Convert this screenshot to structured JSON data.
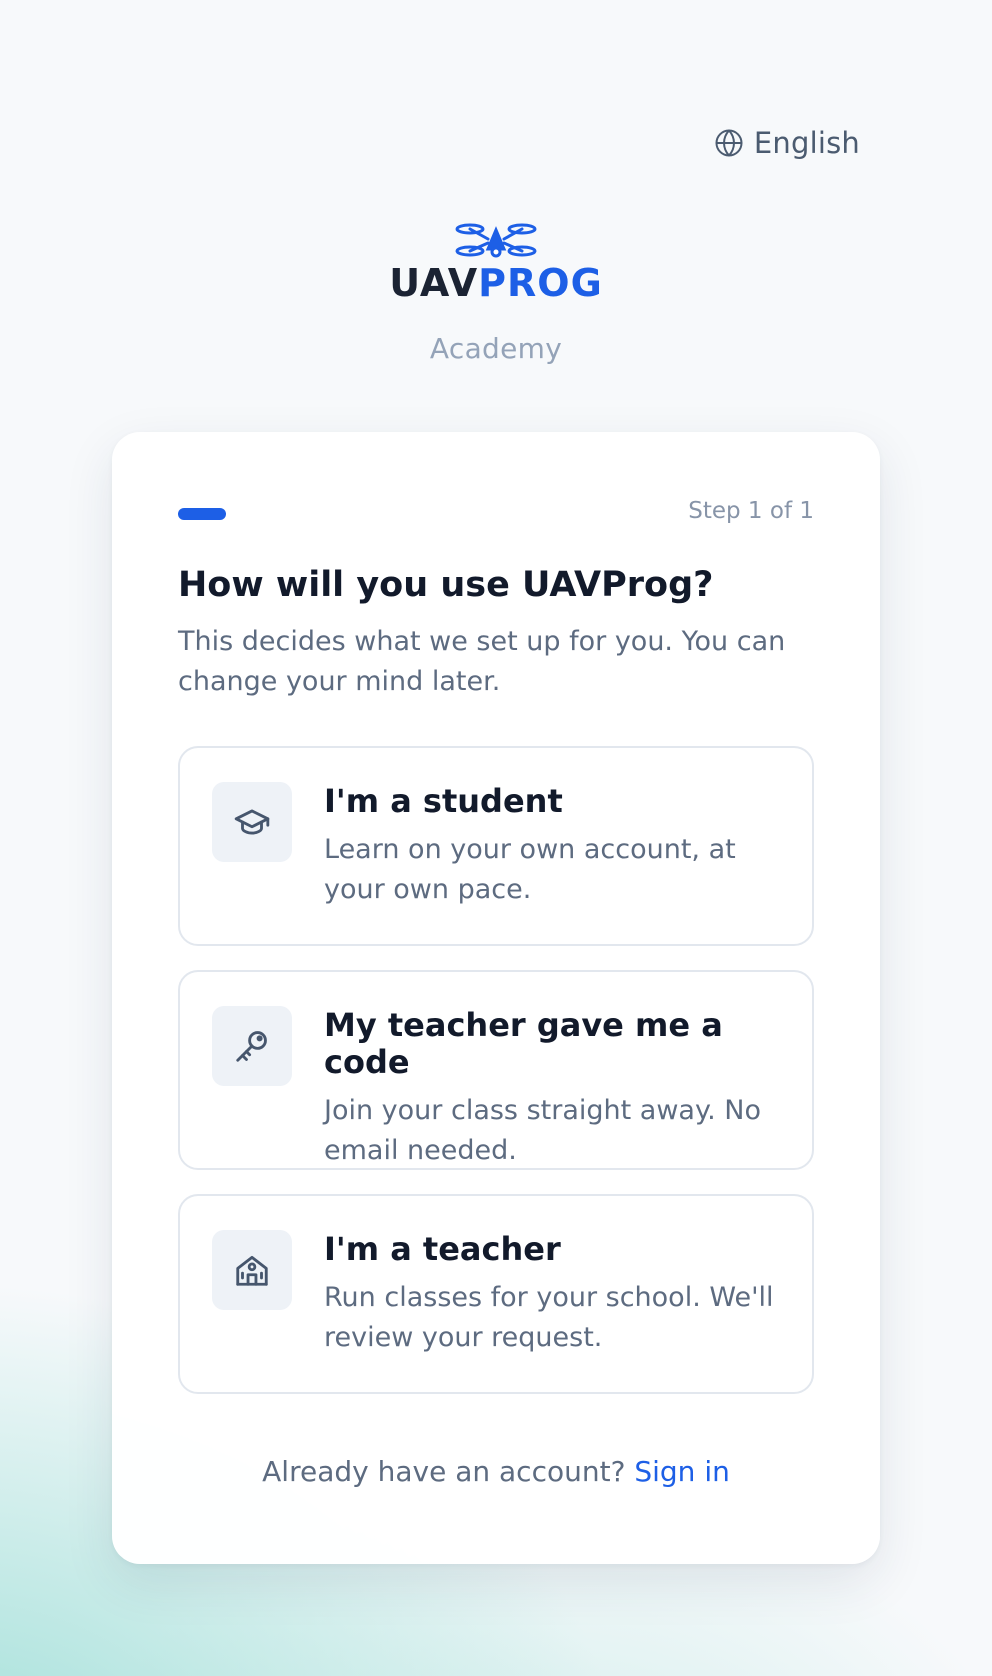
{
  "language": {
    "label": "English",
    "icon": "globe-icon"
  },
  "brand": {
    "logo_part_a": "UAV",
    "logo_part_b": "PROG",
    "subtitle": "Academy",
    "colors": {
      "dark": "#1b2333",
      "blue": "#1d5fe6"
    }
  },
  "progress": {
    "step_label": "Step 1 of 1",
    "current_step": 1,
    "total_steps": 1
  },
  "heading": "How will you use UAVProg?",
  "description": "This decides what we set up for you. You can change your mind later.",
  "options": [
    {
      "icon": "graduation-cap-icon",
      "title": "I'm a student",
      "description": "Learn on your own account, at your own pace."
    },
    {
      "icon": "key-icon",
      "title": "My teacher gave me a code",
      "description": "Join your class straight away. No email needed."
    },
    {
      "icon": "school-icon",
      "title": "I'm a teacher",
      "description": "Run classes for your school. We'll review your request."
    }
  ],
  "footer": {
    "prompt": "Already have an account?",
    "link": "Sign in"
  },
  "accent_color": "#1d5fe6"
}
